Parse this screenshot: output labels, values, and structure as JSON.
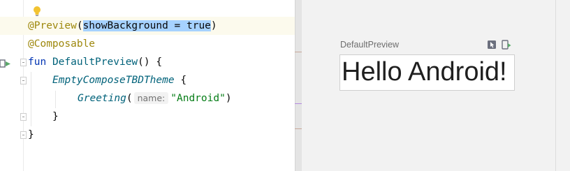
{
  "editor": {
    "line1": {
      "annotation": "@Preview",
      "open_paren": "(",
      "selected_args": "showBackground = true",
      "close_paren": ")"
    },
    "line2": {
      "annotation": "@Composable"
    },
    "line3": {
      "keyword": "fun",
      "function_name": "DefaultPreview",
      "rest": "() {"
    },
    "line4": {
      "call": "EmptyComposeTBDTheme",
      "rest": " {"
    },
    "line5": {
      "call": "Greeting",
      "open_paren": "(",
      "param_hint": "name:",
      "string_arg": "\"Android\"",
      "close_paren": ")"
    },
    "line6": {
      "text": "}"
    },
    "line7": {
      "text": "}"
    }
  },
  "preview": {
    "title": "DefaultPreview",
    "rendered_text": "Hello Android!",
    "icons": [
      "interactive-mode-icon",
      "deploy-to-device-icon"
    ]
  },
  "colors": {
    "keyword": "#0033b3",
    "annotation": "#9e880d",
    "function": "#00627a",
    "string": "#067d17",
    "selection": "#a6d2ff",
    "current_line": "#fcfaed",
    "preview_background": "#f2f2f2"
  }
}
